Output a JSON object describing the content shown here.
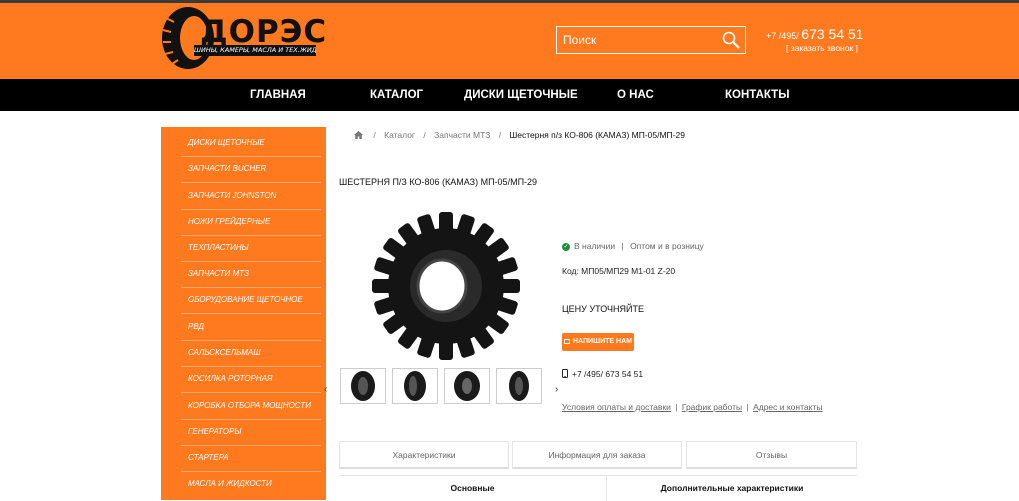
{
  "header": {
    "logo_text": "ДОРЭС",
    "logo_sub": "ШИНЫ, КАМЕРЫ, МАСЛА И ТЕХ.ЖИДКОСТИ",
    "search_placeholder": "Поиск",
    "phone_prefix": "+7 /495/",
    "phone_number": "673 54 51",
    "callback": "[ заказать звонок ]",
    "accent_color": "#ff7a1f"
  },
  "nav": {
    "items": [
      "ГЛАВНАЯ",
      "КАТАЛОГ",
      "ДИСКИ ЩЕТОЧНЫЕ",
      "О НАС",
      "КОНТАКТЫ"
    ]
  },
  "sidebar": {
    "items": [
      "ДИСКИ ЩЕТОЧНЫЕ",
      "ЗАПЧАСТИ BUCHER",
      "ЗАПЧАСТИ JOHNSTON",
      "НОЖИ ГРЕЙДЕРНЫЕ",
      "ТЕХПЛАСТИНЫ",
      "ЗАПЧАСТИ МТЗ",
      "ОБОРУДОВАНИЕ ЩЕТОЧНОЕ",
      "РВД",
      "САЛЬСКСЕЛЬМАШ",
      "КОСИЛКА РОТОРНАЯ",
      "КОРОБКА ОТБОРА МОЩНОСТИ",
      "ГЕНЕРАТОРЫ",
      "СТАРТЕРА",
      "МАСЛА И ЖИДКОСТИ"
    ]
  },
  "breadcrumb": {
    "items": [
      "Каталог",
      "Запчасти МТЗ"
    ],
    "current": "Шестерня п/з КО-806 (КАМАЗ) МП-05/МП-29",
    "separator": "/"
  },
  "product": {
    "title": "ШЕСТЕРНЯ П/З КО-806 (КАМАЗ) МП-05/МП-29",
    "stock": "В наличии",
    "stock_extra": "Оптом и в розницу",
    "code": "Код: МП05/МП29 М1-01 Z-20",
    "price": "ЦЕНУ УТОЧНЯЙТЕ",
    "write_button": "НАПИШИТЕ НАМ",
    "phone": "+7 /495/ 673 54 51",
    "links": [
      "Условия оплаты и доставки",
      "График работы",
      "Адрес и контакты"
    ]
  },
  "tabs": [
    "Характеристики",
    "Информация для заказа",
    "Отзывы"
  ],
  "subtabs": [
    "Основные",
    "Дополнительные характеристики"
  ]
}
